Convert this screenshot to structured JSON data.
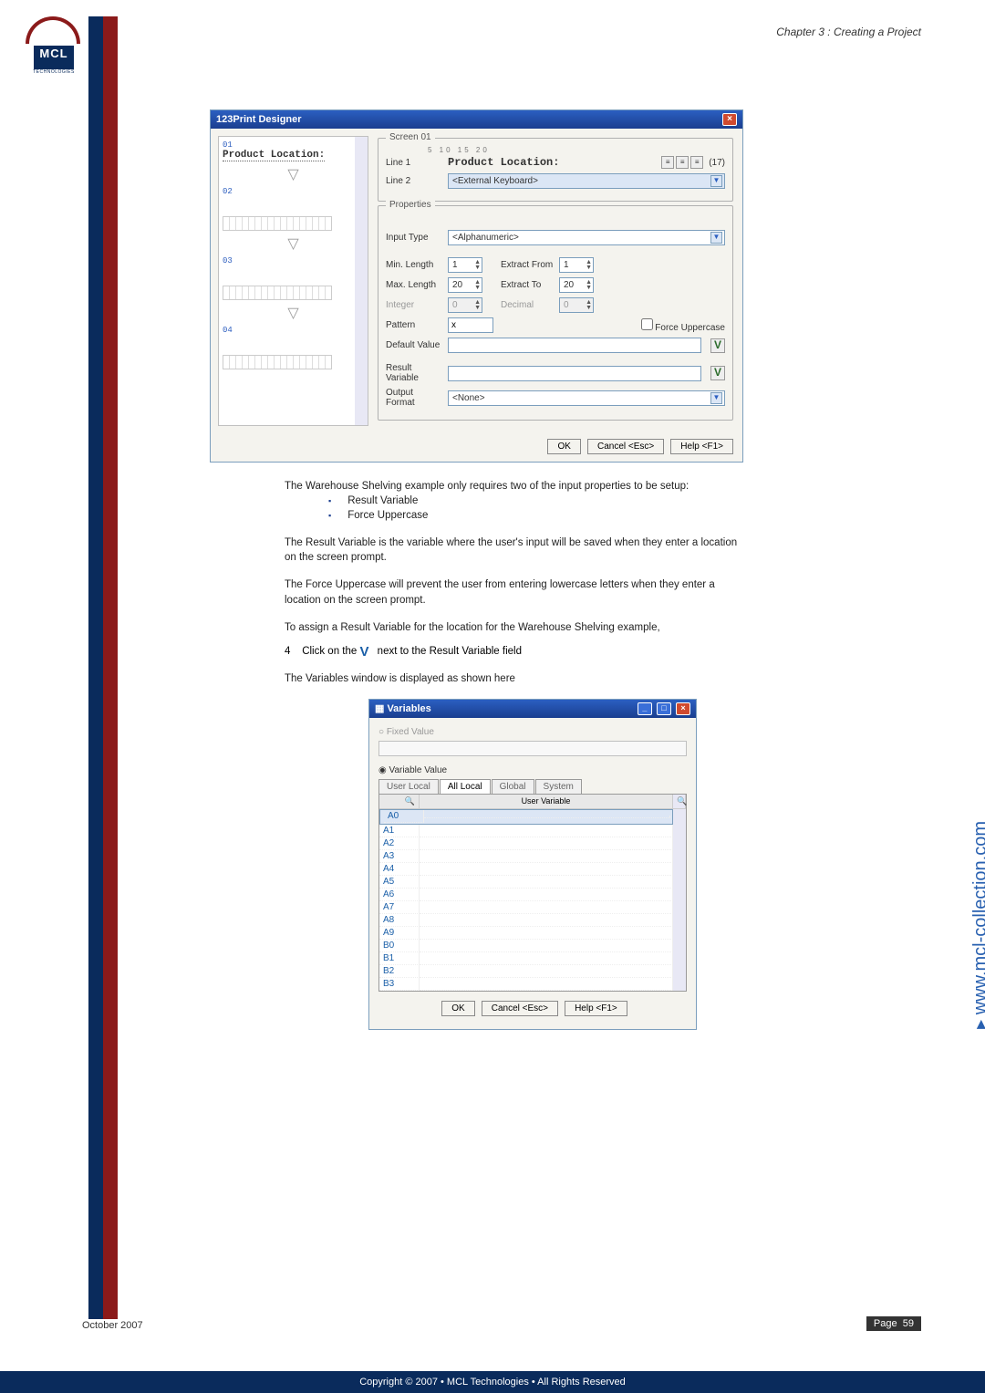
{
  "header": {
    "chapter": "Chapter 3 : Creating a Project"
  },
  "logo": {
    "letters": "MCL",
    "sub": "TECHNOLOGIES"
  },
  "designer": {
    "title": "123Print Designer",
    "left": {
      "n01": "01",
      "product": "Product Location:",
      "n02": "02",
      "n03": "03",
      "n04": "04"
    },
    "screen": {
      "legend": "Screen 01",
      "ruler": "5     10     15     20",
      "line1_label": "Line 1",
      "line1_text": "Product Location:",
      "count": "(17)",
      "line2_label": "Line 2",
      "line2_text": "<External Keyboard>"
    },
    "props": {
      "legend": "Properties",
      "input_type_l": "Input Type",
      "input_type_v": "<Alphanumeric>",
      "min_l": "Min. Length",
      "min_v": "1",
      "exfrom_l": "Extract From",
      "exfrom_v": "1",
      "max_l": "Max. Length",
      "max_v": "20",
      "exto_l": "Extract To",
      "exto_v": "20",
      "int_l": "Integer",
      "int_v": "0",
      "dec_l": "Decimal",
      "dec_v": "0",
      "pat_l": "Pattern",
      "pat_v": "x",
      "force_l": "Force Uppercase",
      "def_l": "Default Value",
      "res_l": "Result Variable",
      "out_l": "Output Format",
      "out_v": "<None>"
    },
    "buttons": {
      "ok": "OK",
      "cancel": "Cancel <Esc>",
      "help": "Help <F1>"
    }
  },
  "text": {
    "p1": "The Warehouse Shelving example only requires two of the input properties to be setup:",
    "b1": "Result Variable",
    "b2": "Force Uppercase",
    "p2": "The Result Variable is the variable where the user's input will be saved when they enter a location on the screen prompt.",
    "p3": "The Force Uppercase will prevent the user from entering lowercase letters when they enter a location on the screen prompt.",
    "p4": "To assign a Result Variable for the location for the Warehouse Shelving example,",
    "step_n": "4",
    "step_t_a": "Click on the ",
    "step_t_b": " next to the Result Variable field",
    "p5": "The Variables window is displayed as shown here"
  },
  "variables": {
    "title": "Variables",
    "r1": "Fixed Value",
    "r2": "Variable Value",
    "tabs": {
      "t1": "User Local",
      "t2": "All Local",
      "t3": "Global",
      "t4": "System"
    },
    "hdr": "User Variable",
    "rows": [
      "A0",
      "A1",
      "A2",
      "A3",
      "A4",
      "A5",
      "A6",
      "A7",
      "A8",
      "A9",
      "B0",
      "B1",
      "B2",
      "B3"
    ],
    "ok": "OK",
    "cancel": "Cancel <Esc>",
    "help": "Help <F1>"
  },
  "side_url": "www.mcl-collection.com",
  "footer": {
    "date": "October 2007",
    "page_l": "Page",
    "page_n": "59",
    "copyright": "Copyright © 2007 • MCL Technologies • All Rights Reserved"
  }
}
